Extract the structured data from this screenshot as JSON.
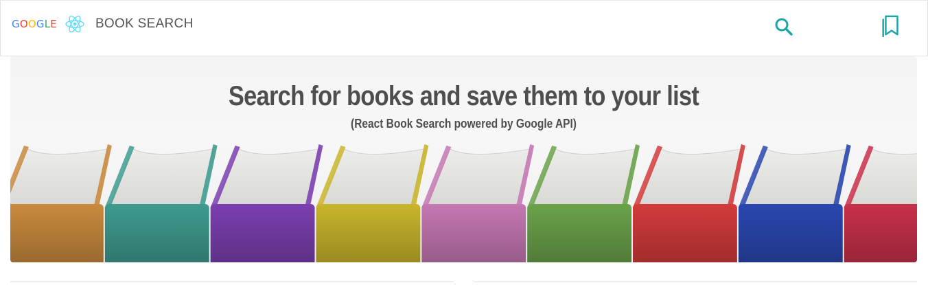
{
  "navbar": {
    "brand_google_letters": [
      {
        "ch": "G",
        "color": "#4285F4"
      },
      {
        "ch": "O",
        "color": "#EA4335"
      },
      {
        "ch": "O",
        "color": "#FBBC05"
      },
      {
        "ch": "G",
        "color": "#4285F4"
      },
      {
        "ch": "L",
        "color": "#34A853"
      },
      {
        "ch": "E",
        "color": "#EA4335"
      }
    ],
    "brand_title": "BOOK SEARCH",
    "react_logo_icon": "react-atom-icon",
    "search_icon": "search-icon",
    "saved_icon": "bookmarks-icon",
    "accent_color": "#1aa6a6"
  },
  "hero": {
    "title": "Search for books and save them to your list",
    "subtitle": "(React Book Search powered by Google API)",
    "book_colors": [
      "#c98a3e",
      "#3f9b8f",
      "#7b3fb0",
      "#c9b52c",
      "#c578b3",
      "#6aa24a",
      "#d33b3b",
      "#2a47b0",
      "#c8304a"
    ]
  }
}
